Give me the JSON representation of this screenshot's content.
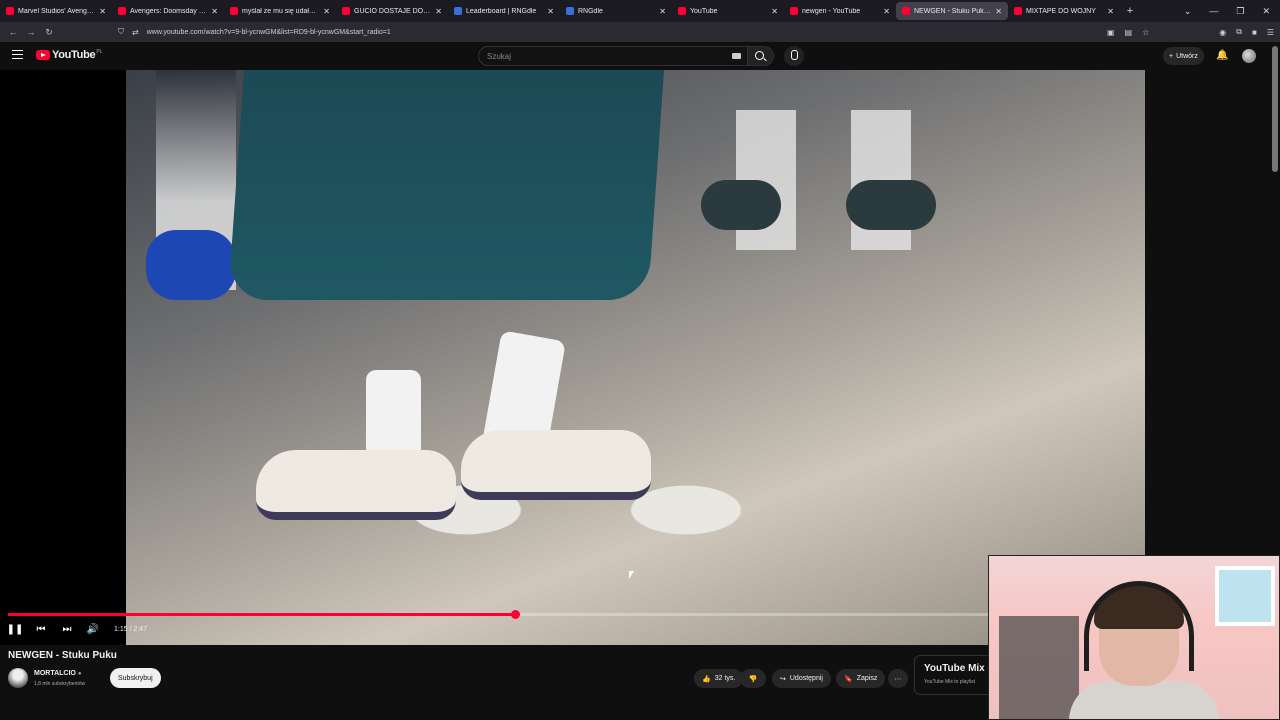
{
  "browser": {
    "tabs": [
      {
        "title": "Marvel Studios' Avengers: Infin",
        "icon": "youtube-icon",
        "active": false
      },
      {
        "title": "Avengers: Doomsday | Special",
        "icon": "youtube-icon",
        "active": false
      },
      {
        "title": "myślał że mu się udało... - YouT",
        "icon": "youtube-icon",
        "active": false
      },
      {
        "title": "GUCIO DOSTAJE DOJAZDI STR",
        "icon": "youtube-icon",
        "active": false
      },
      {
        "title": "Leaderboard | RNGdle",
        "icon": "globe-icon",
        "active": false
      },
      {
        "title": "RNGdle",
        "icon": "globe-icon",
        "active": false
      },
      {
        "title": "YouTube",
        "icon": "youtube-icon",
        "active": false
      },
      {
        "title": "newgen - YouTube",
        "icon": "youtube-icon",
        "active": false
      },
      {
        "title": "NEWGEN - Stuku Puku - Yo",
        "icon": "youtube-icon",
        "active": true
      },
      {
        "title": "MIXTAPE DO WOJNY",
        "icon": "youtube-icon",
        "active": false
      }
    ],
    "new_tab": "+",
    "url": "www.youtube.com/watch?v=9-bl-ycnwGM&list=RD9-bl-ycnwGM&start_radio=1"
  },
  "youtube": {
    "logo_text": "YouTube",
    "region": "PL",
    "search_placeholder": "Szukaj",
    "create_label": "Utwórz",
    "video": {
      "title": "NEWGEN - Stuku Puku",
      "current_time": "1:15",
      "duration": "2:47",
      "time_display": "1:15 / 2:47",
      "progress_fraction": 0.449
    },
    "channel": {
      "name": "MORTALCIO",
      "verified": true,
      "subscribers": "1,8 mln subskrybentów",
      "subscribe_label": "Subskrybuj"
    },
    "actions": {
      "likes": "32 tys.",
      "share": "Udostępnij",
      "save": "Zapisz"
    },
    "mix": {
      "title": "YouTube Mix -",
      "subtitle": "YouTube Mix to playlist"
    }
  },
  "colors": {
    "accent": "#ff0033",
    "background": "#0f0f0f"
  }
}
